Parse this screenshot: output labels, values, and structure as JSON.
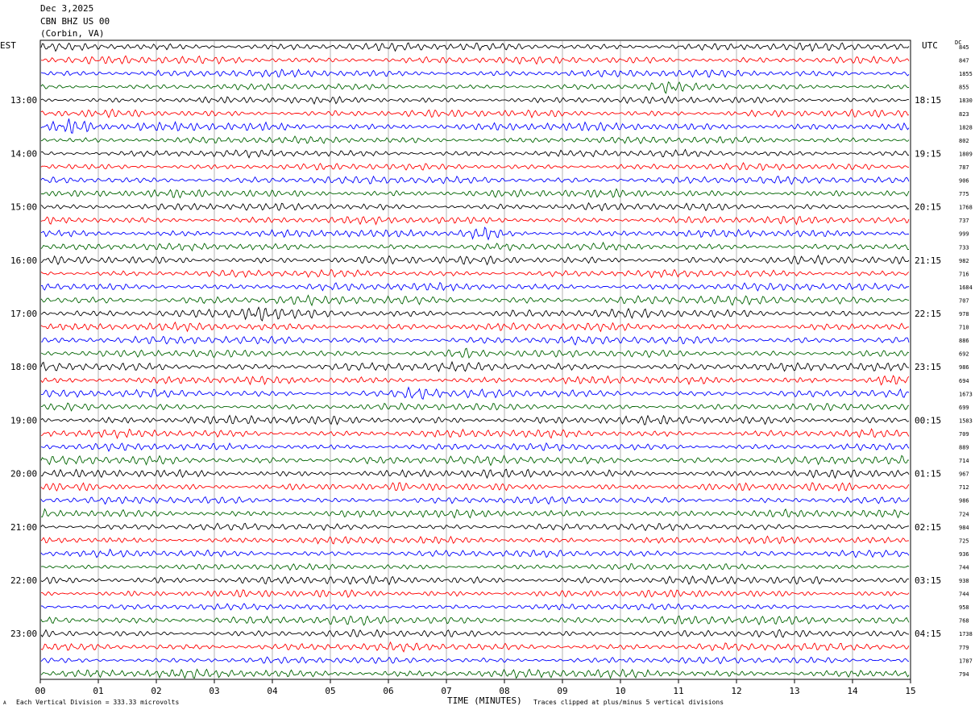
{
  "header": {
    "date": "Dec 3,2025",
    "station": "CBN BHZ US 00",
    "location": "(Corbin, VA)"
  },
  "left_tz": "EST",
  "right_tz": "UTC",
  "dc_label": "DC",
  "footer": {
    "scale": "Each Vertical Division =  333.33 microvolts",
    "clip": "Traces clipped at plus/minus 5 vertical divisions",
    "corner_mark": "A"
  },
  "colors": {
    "trace_cycle": [
      "#000000",
      "#ff0000",
      "#0000ff",
      "#006400"
    ],
    "grid": "#808080"
  },
  "chart_data": {
    "type": "line",
    "subtype": "helicorder",
    "xlabel": "TIME (MINUTES)",
    "x_ticks": [
      "00",
      "01",
      "02",
      "03",
      "04",
      "05",
      "06",
      "07",
      "08",
      "09",
      "10",
      "11",
      "12",
      "13",
      "14",
      "15"
    ],
    "xlim": [
      0,
      15
    ],
    "left_labels": [
      "13:00",
      "14:00",
      "15:00",
      "16:00",
      "17:00",
      "18:00",
      "19:00",
      "20:00",
      "21:00",
      "22:00",
      "23:00"
    ],
    "right_labels": [
      "18:15",
      "19:15",
      "20:15",
      "21:15",
      "22:15",
      "23:15",
      "00:15",
      "01:15",
      "02:15",
      "03:15",
      "04:15"
    ],
    "hour_label_row_start": 4,
    "rows_per_hour": 4,
    "row_count": 48,
    "dc_offsets": [
      "845",
      "847",
      "1855",
      "855",
      "1830",
      "823",
      "1828",
      "802",
      "1809",
      "787",
      "906",
      "775",
      "1768",
      "737",
      "999",
      "733",
      "982",
      "716",
      "1684",
      "707",
      "978",
      "710",
      "886",
      "692",
      "986",
      "694",
      "1673",
      "699",
      "1583",
      "709",
      "889",
      "714",
      "967",
      "712",
      "986",
      "724",
      "984",
      "725",
      "936",
      "744",
      "938",
      "744",
      "958",
      "768",
      "1738",
      "779",
      "1787",
      "794"
    ],
    "events": [
      {
        "row": 6,
        "minute": 0.6,
        "amp": 1.8
      },
      {
        "row": 14,
        "minute": 7.6,
        "amp": 1.7
      },
      {
        "row": 20,
        "minute": 3.8,
        "amp": 1.6
      },
      {
        "row": 23,
        "minute": 7.4,
        "amp": 1.5
      },
      {
        "row": 25,
        "minute": 14.5,
        "amp": 1.6
      },
      {
        "row": 26,
        "minute": 6.5,
        "amp": 1.8
      },
      {
        "row": 3,
        "minute": 10.8,
        "amp": 1.4
      }
    ]
  }
}
